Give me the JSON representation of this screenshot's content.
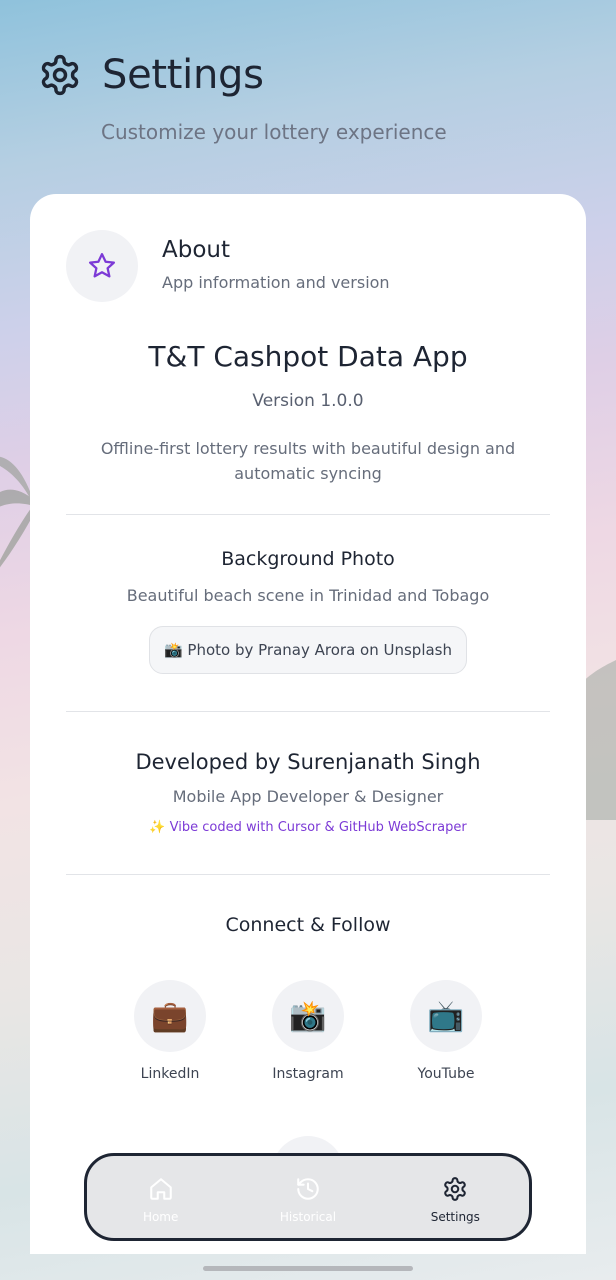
{
  "header": {
    "title": "Settings",
    "subtitle": "Customize your lottery experience"
  },
  "about": {
    "title": "About",
    "subtitle": "App information and version",
    "app_name": "T&T Cashpot Data App",
    "version": "Version 1.0.0",
    "description": "Offline-first lottery results with beautiful design and automatic syncing"
  },
  "background_photo": {
    "title": "Background Photo",
    "description": "Beautiful beach scene in Trinidad and Tobago",
    "credit_button": "📸 Photo by Pranay Arora on Unsplash"
  },
  "developer": {
    "title": "Developed by Surenjanath Singh",
    "role": "Mobile App Developer & Designer",
    "vibe": "✨ Vibe coded with Cursor & GitHub WebScraper"
  },
  "connect": {
    "title": "Connect & Follow",
    "items": [
      {
        "label": "LinkedIn",
        "emoji": "💼",
        "icon": "briefcase-icon"
      },
      {
        "label": "Instagram",
        "emoji": "📸",
        "icon": "camera-icon"
      },
      {
        "label": "YouTube",
        "emoji": "📺",
        "icon": "television-icon"
      }
    ]
  },
  "nav": {
    "items": [
      {
        "label": "Home",
        "icon": "home-icon",
        "active": false
      },
      {
        "label": "Historical",
        "icon": "history-icon",
        "active": false
      },
      {
        "label": "Settings",
        "icon": "gear-icon",
        "active": true
      }
    ]
  },
  "colors": {
    "text_primary": "#1e2533",
    "text_secondary": "#666d7b",
    "accent_purple": "#7c3ad6",
    "card_bg": "#ffffff"
  }
}
